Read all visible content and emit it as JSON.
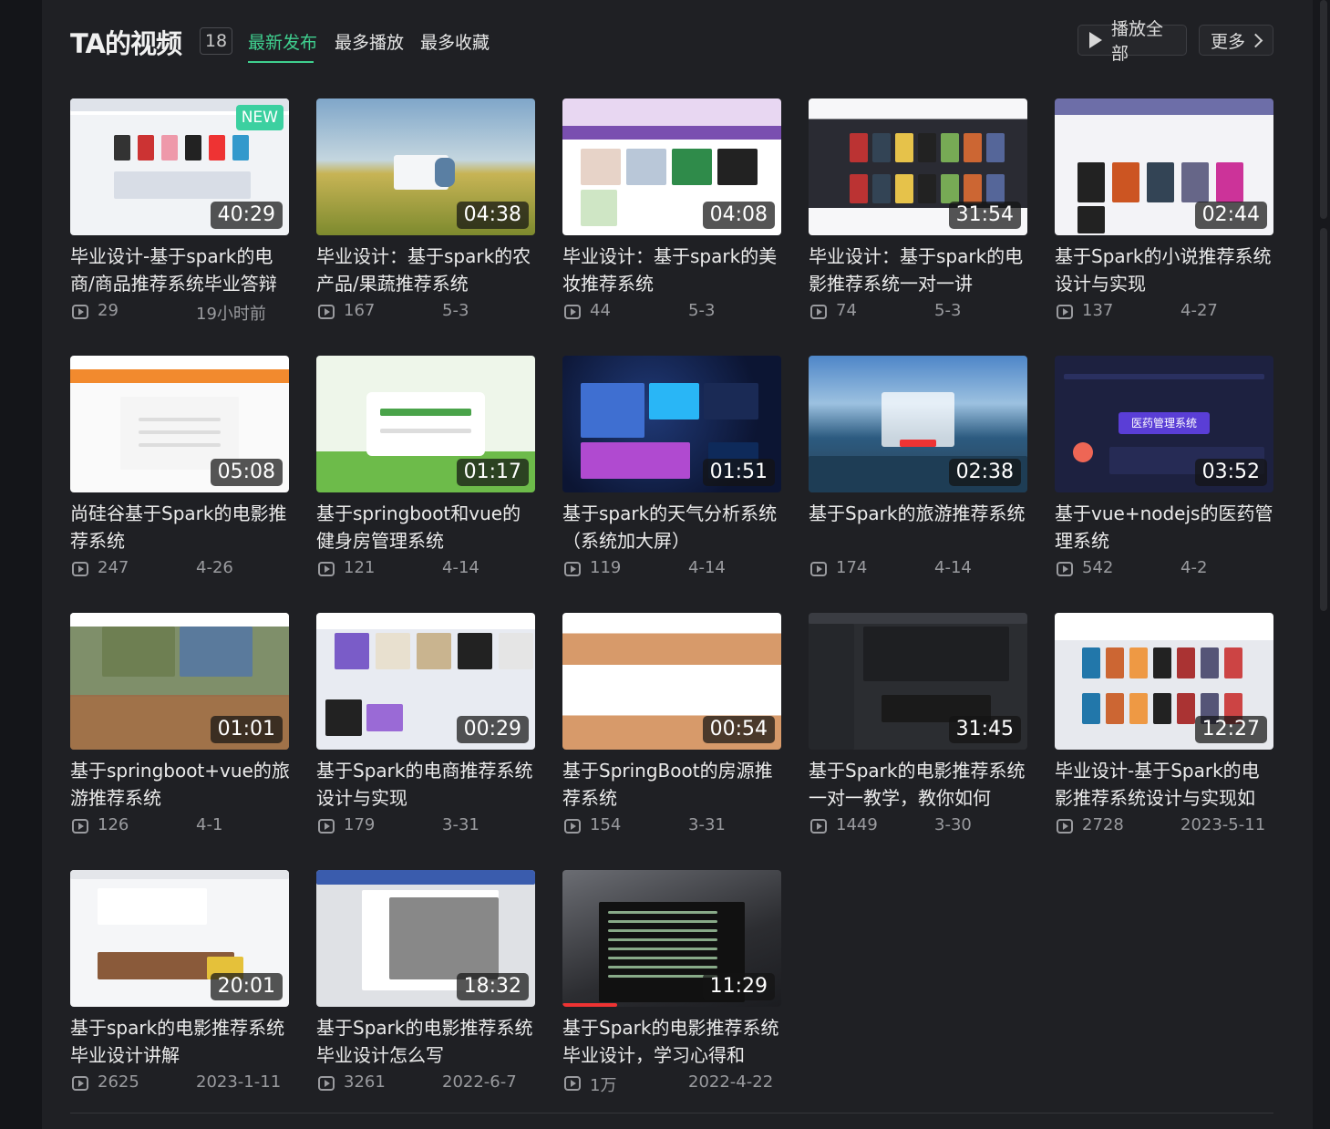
{
  "header": {
    "title": "TA的视频",
    "count": "18",
    "tabs": [
      {
        "label": "最新发布",
        "active": true
      },
      {
        "label": "最多播放",
        "active": false
      },
      {
        "label": "最多收藏",
        "active": false
      }
    ],
    "play_all_label": "播放全部",
    "more_label": "更多"
  },
  "colors": {
    "accent": "#3fd08f",
    "background": "#1f2024",
    "new_badge": "#3cd0a0"
  },
  "videos": [
    {
      "title": "毕业设计-基于spark的电商/商品推荐系统毕业答辩",
      "duration": "40:29",
      "plays": "29",
      "date": "19小时前",
      "badge": "NEW",
      "thumb": "web-shop"
    },
    {
      "title": "毕业设计：基于spark的农产品/果蔬推荐系统",
      "duration": "04:38",
      "plays": "167",
      "date": "5-3",
      "thumb": "wheat-field"
    },
    {
      "title": "毕业设计：基于spark的美妆推荐系统",
      "duration": "04:08",
      "plays": "44",
      "date": "5-3",
      "thumb": "beauty-site"
    },
    {
      "title": "毕业设计：基于spark的电影推荐系统一对一讲",
      "duration": "31:54",
      "plays": "74",
      "date": "5-3",
      "thumb": "movie-grid"
    },
    {
      "title": "基于Spark的小说推荐系统设计与实现",
      "duration": "02:44",
      "plays": "137",
      "date": "4-27",
      "thumb": "novel-site"
    },
    {
      "title": "尚硅谷基于Spark的电影推荐系统",
      "duration": "05:08",
      "plays": "247",
      "date": "4-26",
      "thumb": "movielens-login"
    },
    {
      "title": "基于springboot和vue的健身房管理系统",
      "duration": "01:17",
      "plays": "121",
      "date": "4-14",
      "thumb": "green-login"
    },
    {
      "title": "基于spark的天气分析系统（系统加大屏）",
      "duration": "01:51",
      "plays": "119",
      "date": "4-14",
      "thumb": "dashboard"
    },
    {
      "title": "基于Spark的旅游推荐系统",
      "duration": "02:38",
      "plays": "174",
      "date": "4-14",
      "thumb": "lake-login"
    },
    {
      "title": "基于vue+nodejs的医药管理系统",
      "duration": "03:52",
      "plays": "542",
      "date": "4-2",
      "thumb": "medical-dashboard",
      "overlay": "医药管理系统"
    },
    {
      "title": "基于springboot+vue的旅游推荐系统",
      "duration": "01:01",
      "plays": "126",
      "date": "4-1",
      "thumb": "travel-photos"
    },
    {
      "title": "基于Spark的电商推荐系统设计与实现",
      "duration": "00:29",
      "plays": "179",
      "date": "3-31",
      "thumb": "shop-products"
    },
    {
      "title": "基于SpringBoot的房源推荐系统",
      "duration": "00:54",
      "plays": "154",
      "date": "3-31",
      "thumb": "house-listings"
    },
    {
      "title": "基于Spark的电影推荐系统一对一教学，教你如何",
      "duration": "31:45",
      "plays": "1449",
      "date": "3-30",
      "thumb": "ide"
    },
    {
      "title": "毕业设计-基于Spark的电影推荐系统设计与实现如",
      "duration": "12:27",
      "plays": "2728",
      "date": "2023-5-11",
      "thumb": "movie-posters"
    },
    {
      "title": "基于spark的电影推荐系统毕业设计讲解",
      "duration": "20:01",
      "plays": "2625",
      "date": "2023-1-11",
      "thumb": "doc-page"
    },
    {
      "title": "基于Spark的电影推荐系统毕业设计怎么写",
      "duration": "18:32",
      "plays": "3261",
      "date": "2022-6-7",
      "thumb": "word-doc"
    },
    {
      "title": "基于Spark的电影推荐系统毕业设计，学习心得和",
      "duration": "11:29",
      "plays": "1万",
      "date": "2022-4-22",
      "thumb": "terminal-photo"
    }
  ]
}
